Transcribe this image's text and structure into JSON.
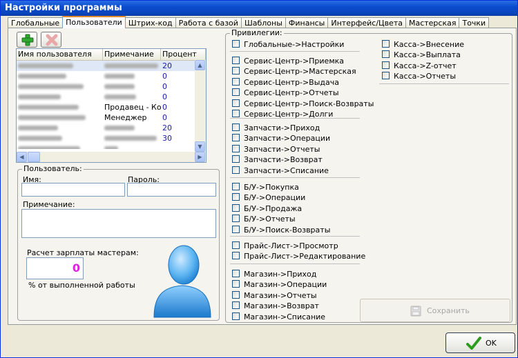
{
  "window": {
    "title": "Настройки программы"
  },
  "tabs": [
    "Глобальные",
    "Пользователи",
    "Штрих-код",
    "Работа с базой",
    "Шаблоны",
    "Финансы",
    "Интерфейс/Цвета",
    "Мастерская",
    "Точки"
  ],
  "users_table": {
    "columns": [
      "Имя пользователя",
      "Примечание",
      "Процент"
    ],
    "rows": [
      {
        "name": "",
        "note": "",
        "percent": "20"
      },
      {
        "name": "",
        "note": "",
        "percent": "0"
      },
      {
        "name": "",
        "note": "",
        "percent": "0"
      },
      {
        "name": "",
        "note": "",
        "percent": "0"
      },
      {
        "name": "",
        "note": "Продавец - Ко...",
        "percent": "0"
      },
      {
        "name": "",
        "note": "Менеджер",
        "percent": "0"
      },
      {
        "name": "",
        "note": "",
        "percent": "20"
      },
      {
        "name": "",
        "note": "",
        "percent": "30"
      },
      {
        "name": "",
        "note": "",
        "percent": ""
      }
    ]
  },
  "user_form": {
    "group_title": "Пользователь:",
    "name_label": "Имя:",
    "password_label": "Пароль:",
    "note_label": "Примечание:",
    "salary_label": "Расчет зарплаты мастерам:",
    "salary_value": "0",
    "salary_hint": "% от выполненной работы"
  },
  "privileges": {
    "group_title": "Привилегии:",
    "col1": [
      [
        "Глобальные->Настройки"
      ],
      [
        "Сервис-Центр->Приемка",
        "Сервис-Центр->Мастерская",
        "Сервис-Центр->Выдача",
        "Сервис-Центр->Отчеты",
        "Сервис-Центр->Поиск-Возвраты",
        "Сервис-Центр->Долги"
      ],
      [
        "Запчасти->Приход",
        "Запчасти->Операции",
        "Запчасти->Отчеты",
        "Запчасти->Возврат",
        "Запчасти->Списание"
      ],
      [
        "Б/У->Покупка",
        "Б/У->Операции",
        "Б/У->Продажа",
        "Б/У->Отчеты",
        "Б/У->Поиск-Возвраты"
      ],
      [
        "Прайс-Лист->Просмотр",
        "Прайс-Лист->Редактирование"
      ],
      [
        "Магазин->Приход",
        "Магазин->Операции",
        "Магазин->Отчеты",
        "Магазин->Возврат",
        "Магазин->Списание"
      ]
    ],
    "col2": [
      "Касса->Внесение",
      "Касса->Выплата",
      "Касса->Z-отчет",
      "Касса->Отчеты"
    ]
  },
  "buttons": {
    "save": "Сохранить",
    "ok": "OK"
  },
  "colors": {
    "salary_value": "#e020e0",
    "percent_text": "#1a1aa8",
    "title_bar": "#0a4ccc",
    "ok_check": "#2e9c1e"
  }
}
